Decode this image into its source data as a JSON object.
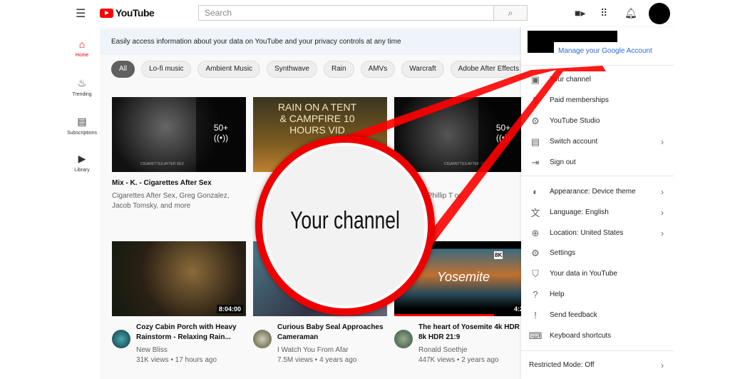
{
  "header": {
    "logo": "YouTube",
    "search_placeholder": "Search",
    "icons": [
      "menu-icon",
      "search-icon",
      "create-video-icon",
      "apps-icon",
      "bell-icon",
      "avatar"
    ]
  },
  "sidebar": {
    "items": [
      {
        "label": "Home",
        "icon": "home-icon",
        "active": true
      },
      {
        "label": "Trending",
        "icon": "fire-icon"
      },
      {
        "label": "Subscriptions",
        "icon": "subscriptions-icon"
      },
      {
        "label": "Library",
        "icon": "library-icon"
      }
    ]
  },
  "banner": "Easily access information about your data on YouTube and your privacy controls at any time",
  "chips": [
    "All",
    "Lo-fi music",
    "Ambient Music",
    "Synthwave",
    "Rain",
    "AMVs",
    "Warcraft",
    "Adobe After Effects"
  ],
  "videos": [
    {
      "title": "Mix - K. - Cigarettes After Sex",
      "meta1": "Cigarettes After Sex, Greg Gonzalez,",
      "meta2": "Jacob Tomsky, and more",
      "badge": "50+",
      "thumb_text": "CIGARETTES AFTER SEX"
    },
    {
      "title": "",
      "meta1": "",
      "meta2": "",
      "thumb_text": "RAIN ON A TENT & CAMPFIRE 10 HOURS VID"
    },
    {
      "title": "",
      "meta1": "After Sex, Phillip T  os,",
      "meta2": "and more",
      "badge": "50+",
      "thumb_text": "CIGARETTES AFTER SEX"
    },
    {
      "title": "Cozy Cabin Porch with Heavy Rainstorm - Relaxing Rain...",
      "channel": "New Bliss",
      "stats": "31K views • 17 hours ago",
      "duration": "8:04:00"
    },
    {
      "title": "Curious Baby Seal Approaches Cameraman",
      "channel": "I Watch You From Afar",
      "stats": "7.5M views • 4 years ago"
    },
    {
      "title": "The heart of Yosemite 4k HDR | 8k HDR 21:9",
      "channel": "Ronald Soethje",
      "stats": "447K views • 2 years ago",
      "duration": "4:2",
      "thumb_text": "Yosemite",
      "badge": "8K"
    }
  ],
  "menu": {
    "manage": "Manage your Google Account",
    "items": [
      {
        "label": "Your channel",
        "icon": "person-icon"
      },
      {
        "label": "Paid memberships",
        "icon": "dollar-icon"
      },
      {
        "label": "YouTube Studio",
        "icon": "gear-icon"
      },
      {
        "label": "Switch account",
        "icon": "switch-account-icon",
        "chevron": true
      },
      {
        "label": "Sign out",
        "icon": "sign-out-icon"
      },
      {
        "label": "Appearance: Device theme",
        "icon": "appearance-icon",
        "chevron": true
      },
      {
        "label": "Language: English",
        "icon": "translate-icon",
        "chevron": true
      },
      {
        "label": "Location: United States",
        "icon": "globe-icon",
        "chevron": true
      },
      {
        "label": "Settings",
        "icon": "gear-icon"
      },
      {
        "label": "Your data in YouTube",
        "icon": "shield-icon"
      },
      {
        "label": "Help",
        "icon": "help-icon"
      },
      {
        "label": "Send feedback",
        "icon": "feedback-icon"
      },
      {
        "label": "Keyboard shortcuts",
        "icon": "keyboard-icon"
      }
    ],
    "restricted": "Restricted Mode: Off"
  },
  "callout": {
    "text": "Your channel",
    "color": "#e00000"
  }
}
